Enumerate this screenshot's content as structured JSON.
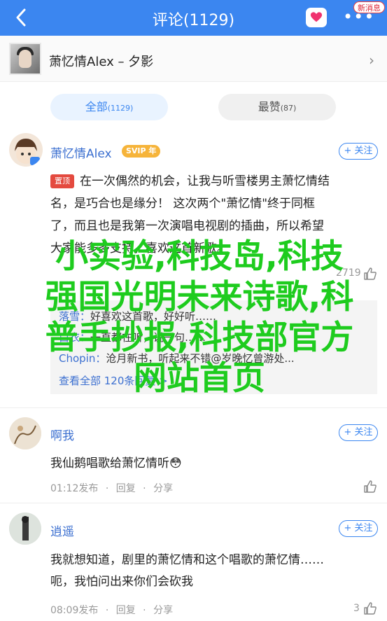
{
  "header": {
    "title": "评论(1129)",
    "badge": "新消息"
  },
  "song": {
    "title": "萧忆情Alex – 夕影"
  },
  "tabs": {
    "all_label": "全部",
    "all_count": "(1129)",
    "hot_label": "最赞",
    "hot_count": "(87)"
  },
  "comments": [
    {
      "user": "萧忆情Alex",
      "vip": "SVIP 年",
      "follow": "+ 关注",
      "pin": "置顶",
      "lines": [
        "在一次偶然的机会，让我与听雪楼男主萧忆情结",
        "名，是巧合也是缘分！ 这次两个\"萧忆情\"终于同框",
        "了，而且也是我第一次演唱电视剧的插曲，所以希望",
        "大家能多多支持，喜欢这首新歌。"
      ],
      "likes": "2719",
      "replies": [
        {
          "name": "落雪：",
          "text": "好喜欢这首歌，好好听……"
        },
        {
          "name": "白衣：",
          "text": "一直都在听，说一句……"
        },
        {
          "name": "Chopin：",
          "text": "沧月新书，听起来不错@岁晚忆曾游处..."
        }
      ],
      "replies_more": "查看全部 120条回复 >"
    },
    {
      "user": "啊我",
      "follow": "+ 关注",
      "text": "我仙鹅唱歌给萧忆情听😳",
      "time": "01:12发布",
      "reply": "回复",
      "share": "分享"
    },
    {
      "user": "逍遥",
      "follow": "+ 关注",
      "lines": [
        "我就想知道，剧里的萧忆情和这个唱歌的萧忆情……",
        "呃，我怕问出来你们会砍我"
      ],
      "time": "08:09发布",
      "reply": "回复",
      "share": "分享",
      "likes": "3"
    }
  ],
  "overlay": {
    "lines": [
      "小实验,科技岛,科技",
      "强国光明未来诗歌,科",
      "普手抄报,科技部官方",
      "网站首页"
    ]
  },
  "colors": {
    "accent": "#3b86f0",
    "watermark": "#1ecc1e",
    "pin": "#e44a3f",
    "vip": "#f6b43a"
  },
  "icons": [
    "back-icon",
    "heart-icon",
    "more-icon",
    "chevron-right-icon",
    "thumb-up-icon"
  ]
}
